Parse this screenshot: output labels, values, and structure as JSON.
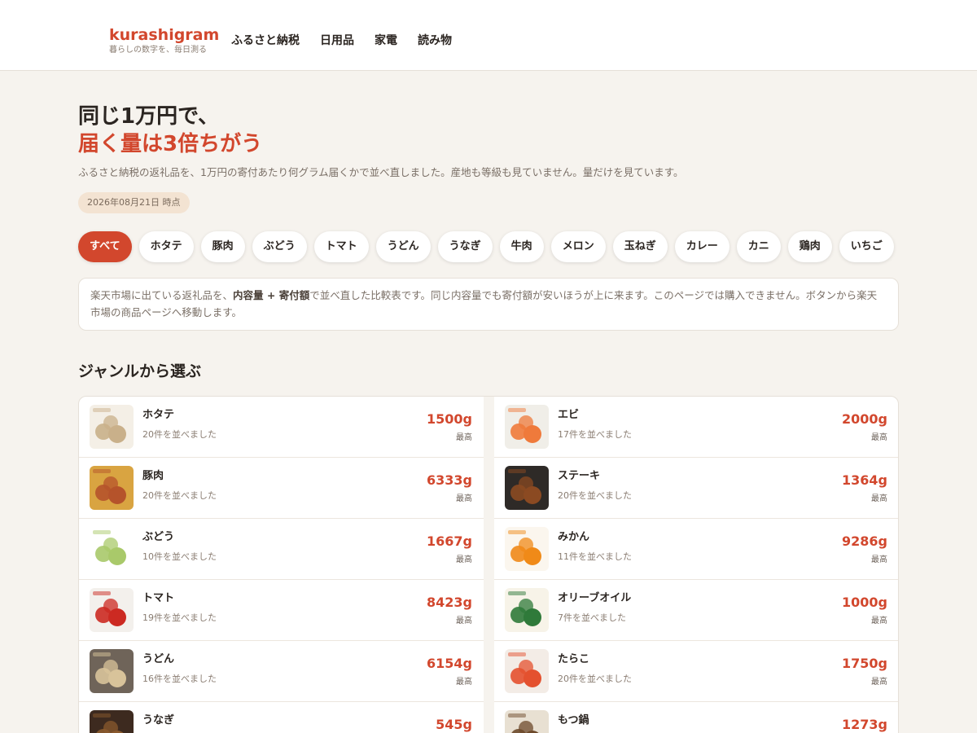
{
  "header": {
    "brand": "kurashigram",
    "tagline": "暮らしの数字を、毎日測る",
    "nav": [
      "ふるさと納税",
      "日用品",
      "家電",
      "読み物"
    ]
  },
  "hero": {
    "title_line1": "同じ1万円で、",
    "title_line2": "届く量は3倍ちがう",
    "description": "ふるさと納税の返礼品を、1万円の寄付あたり何グラム届くかで並べ直しました。産地も等級も見ていません。量だけを見ています。",
    "date_badge": "2026年08月21日 時点"
  },
  "chips": [
    "すべて",
    "ホタテ",
    "豚肉",
    "ぶどう",
    "トマト",
    "うどん",
    "うなぎ",
    "牛肉",
    "メロン",
    "玉ねぎ",
    "カレー",
    "カニ",
    "鶏肉",
    "いちご"
  ],
  "notice": {
    "before": "楽天市場に出ている返礼品を、",
    "bold": "内容量 + 寄付額",
    "after": "で並べ直した比較表です。同じ内容量でも寄付額が安いほうが上に来ます。このページでは購入できません。ボタンから楽天市場の商品ページへ移動します。"
  },
  "section_title": "ジャンルから選ぶ",
  "genres_left": [
    {
      "name": "ホタテ",
      "count": "20件を並べました",
      "weight": "1500g",
      "max_label": "最高",
      "colors": [
        "#f4efe6",
        "#c9b08a"
      ]
    },
    {
      "name": "豚肉",
      "count": "20件を並べました",
      "weight": "6333g",
      "max_label": "最高",
      "colors": [
        "#d9a441",
        "#b5532b"
      ]
    },
    {
      "name": "ぶどう",
      "count": "10件を並べました",
      "weight": "1667g",
      "max_label": "最高",
      "colors": [
        "#ffffff",
        "#a9c96a"
      ]
    },
    {
      "name": "トマト",
      "count": "19件を並べました",
      "weight": "8423g",
      "max_label": "最高",
      "colors": [
        "#f3f0ec",
        "#cc2a22"
      ]
    },
    {
      "name": "うどん",
      "count": "16件を並べました",
      "weight": "6154g",
      "max_label": "最高",
      "colors": [
        "#6f6459",
        "#d8c39a"
      ]
    },
    {
      "name": "うなぎ",
      "count": "",
      "weight": "545g",
      "max_label": "",
      "colors": [
        "#3d2a1f",
        "#8a5a2e"
      ]
    }
  ],
  "genres_right": [
    {
      "name": "エビ",
      "count": "17件を並べました",
      "weight": "2000g",
      "max_label": "最高",
      "colors": [
        "#f0eee8",
        "#ef7a3b"
      ]
    },
    {
      "name": "ステーキ",
      "count": "20件を並べました",
      "weight": "1364g",
      "max_label": "最高",
      "colors": [
        "#2e2a27",
        "#8b4a22"
      ]
    },
    {
      "name": "みかん",
      "count": "11件を並べました",
      "weight": "9286g",
      "max_label": "最高",
      "colors": [
        "#fbf6ee",
        "#f08a18"
      ]
    },
    {
      "name": "オリーブオイル",
      "count": "7件を並べました",
      "weight": "1000g",
      "max_label": "最高",
      "colors": [
        "#f7f3e8",
        "#2f7a3a"
      ]
    },
    {
      "name": "たらこ",
      "count": "20件を並べました",
      "weight": "1750g",
      "max_label": "最高",
      "colors": [
        "#f3ece6",
        "#e4512f"
      ]
    },
    {
      "name": "もつ鍋",
      "count": "",
      "weight": "1273g",
      "max_label": "",
      "colors": [
        "#e8e0d2",
        "#6d4a2b"
      ]
    }
  ]
}
